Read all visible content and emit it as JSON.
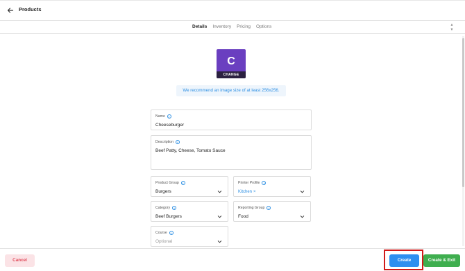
{
  "header": {
    "title": "Products",
    "back_icon": "arrow-left-icon"
  },
  "tabs": [
    {
      "label": "Details",
      "active": true
    },
    {
      "label": "Inventory",
      "active": false
    },
    {
      "label": "Pricing",
      "active": false
    },
    {
      "label": "Options",
      "active": false
    }
  ],
  "image": {
    "letter": "C",
    "change_label": "CHANGE",
    "tile_color": "#6a3fc0",
    "recommendation": "We recommend an image size of at least 256x256."
  },
  "form": {
    "name": {
      "label": "Name",
      "value": "Cheeseburger"
    },
    "description": {
      "label": "Description",
      "value": "Beef Patty, Cheese, Tomato Sauce"
    },
    "product_group": {
      "label": "Product Group",
      "value": "Burgers"
    },
    "printer_profile": {
      "label": "Printer Profile",
      "chip": "Kitchen",
      "chip_remove": "×"
    },
    "category": {
      "label": "Category",
      "value": "Beef Burgers"
    },
    "reporting_group": {
      "label": "Reporting Group",
      "value": "Food"
    },
    "course": {
      "label": "Course",
      "placeholder": "Optional"
    }
  },
  "footer": {
    "cancel_label": "Cancel",
    "create_label": "Create",
    "create_exit_label": "Create & Exit"
  },
  "colors": {
    "accent_blue": "#2e8ff0",
    "success_green": "#3fae4f",
    "danger_red": "#e04a5a",
    "highlight": "#d11a1a"
  }
}
